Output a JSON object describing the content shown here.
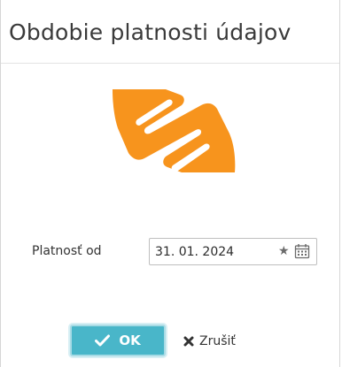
{
  "dialog": {
    "title": "Obdobie platnosti údajov"
  },
  "logo": {
    "icon": "orange-s-logo",
    "color": "#f7941d"
  },
  "form": {
    "valid_from": {
      "label": "Platnosť od",
      "value": "31. 01. 2024",
      "icons": [
        "star-icon",
        "calendar-icon"
      ]
    }
  },
  "buttons": {
    "ok_label": "OK",
    "cancel_label": "Zrušiť"
  },
  "colors": {
    "accent": "#49b6c9",
    "logo": "#f7941d"
  }
}
